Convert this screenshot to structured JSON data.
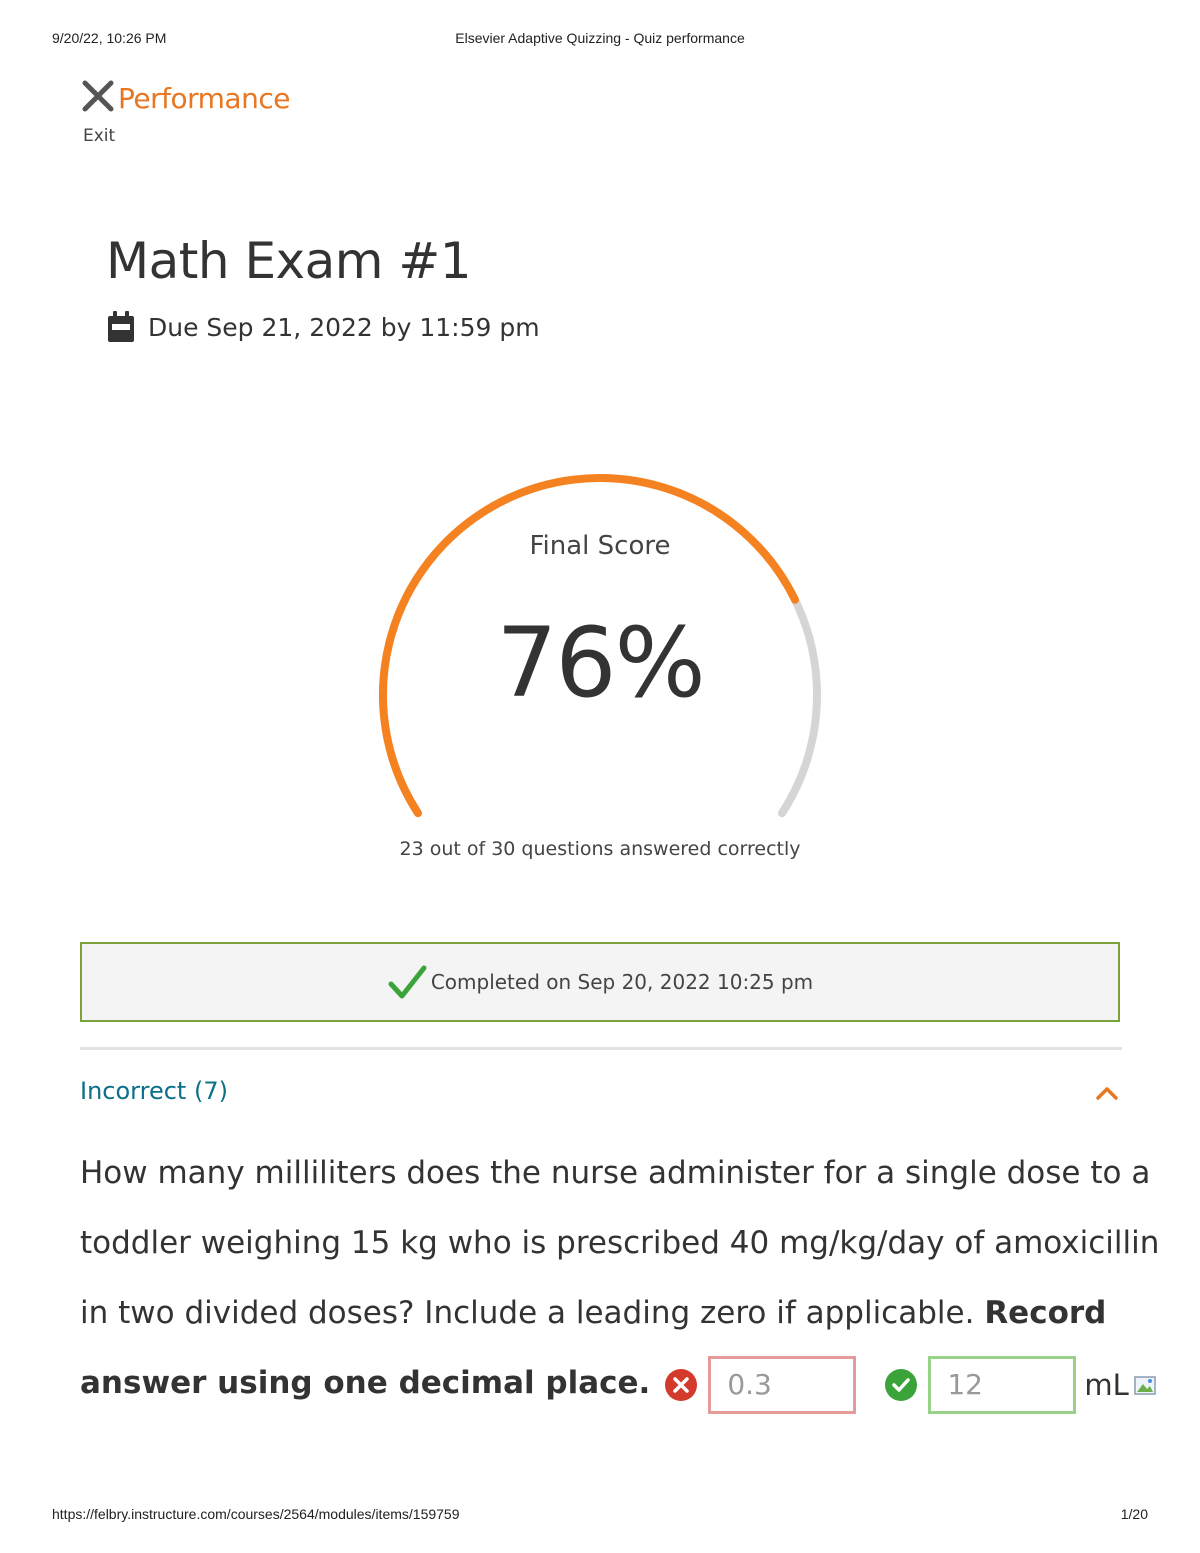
{
  "print_header": {
    "datetime": "9/20/22, 10:26 PM",
    "title": "Elsevier Adaptive Quizzing - Quiz performance"
  },
  "print_footer": {
    "url": "https://felbry.instructure.com/courses/2564/modules/items/159759",
    "page": "1/20"
  },
  "nav": {
    "title": "Performance",
    "exit_label": "Exit",
    "exit_icon": "close-icon"
  },
  "exam": {
    "title": "Math Exam #1",
    "due": "Due Sep 21, 2022 by 11:59 pm"
  },
  "score": {
    "label": "Final Score",
    "value": "76%",
    "fraction": 0.76,
    "answered": "23 out of 30 questions answered correctly"
  },
  "completion": {
    "text": "Completed on Sep 20, 2022 10:25 pm"
  },
  "incorrect_section": {
    "header": "Incorrect (7)",
    "expanded": true
  },
  "question": {
    "line1": "How many milliliters does the nurse administer for a single dose to a",
    "line2": "toddler weighing 15 kg who is prescribed 40 mg/kg/day of amoxicillin",
    "line3_plain": "in two divided doses? Include a leading zero if applicable. ",
    "line3_bold": "Record",
    "line4_bold": "answer using one decimal place.",
    "user_answer": "0.3",
    "correct_answer": "12",
    "unit": "mL"
  },
  "colors": {
    "accent_orange": "#e87722",
    "gauge_track": "#d5d5d5",
    "link_teal": "#0b6f8a",
    "success_green": "#3aa43a",
    "error_red": "#d33a2c"
  }
}
